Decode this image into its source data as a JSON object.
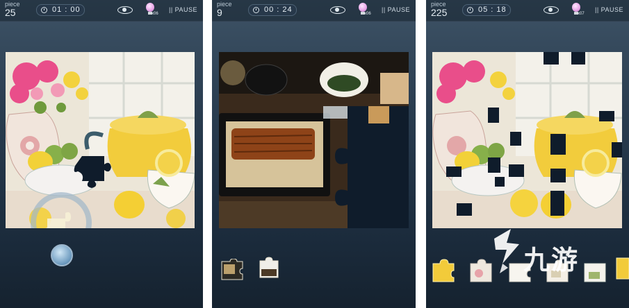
{
  "panels": [
    {
      "piece_label": "piece",
      "piece_count": "25",
      "timer": "01 : 00",
      "hint_count": "x06",
      "pause_label": "|| PAUSE"
    },
    {
      "piece_label": "piece",
      "piece_count": "9",
      "timer": "00 : 24",
      "hint_count": "x06",
      "pause_label": "|| PAUSE"
    },
    {
      "piece_label": "piece",
      "piece_count": "225",
      "timer": "05 : 18",
      "hint_count": "x07",
      "pause_label": "|| PAUSE"
    }
  ],
  "watermark": {
    "text": "九游"
  },
  "colors": {
    "accent_hint": "#e6a2e6",
    "board_dark": "#0f1c2b",
    "lemon": "#f2cc3c"
  }
}
